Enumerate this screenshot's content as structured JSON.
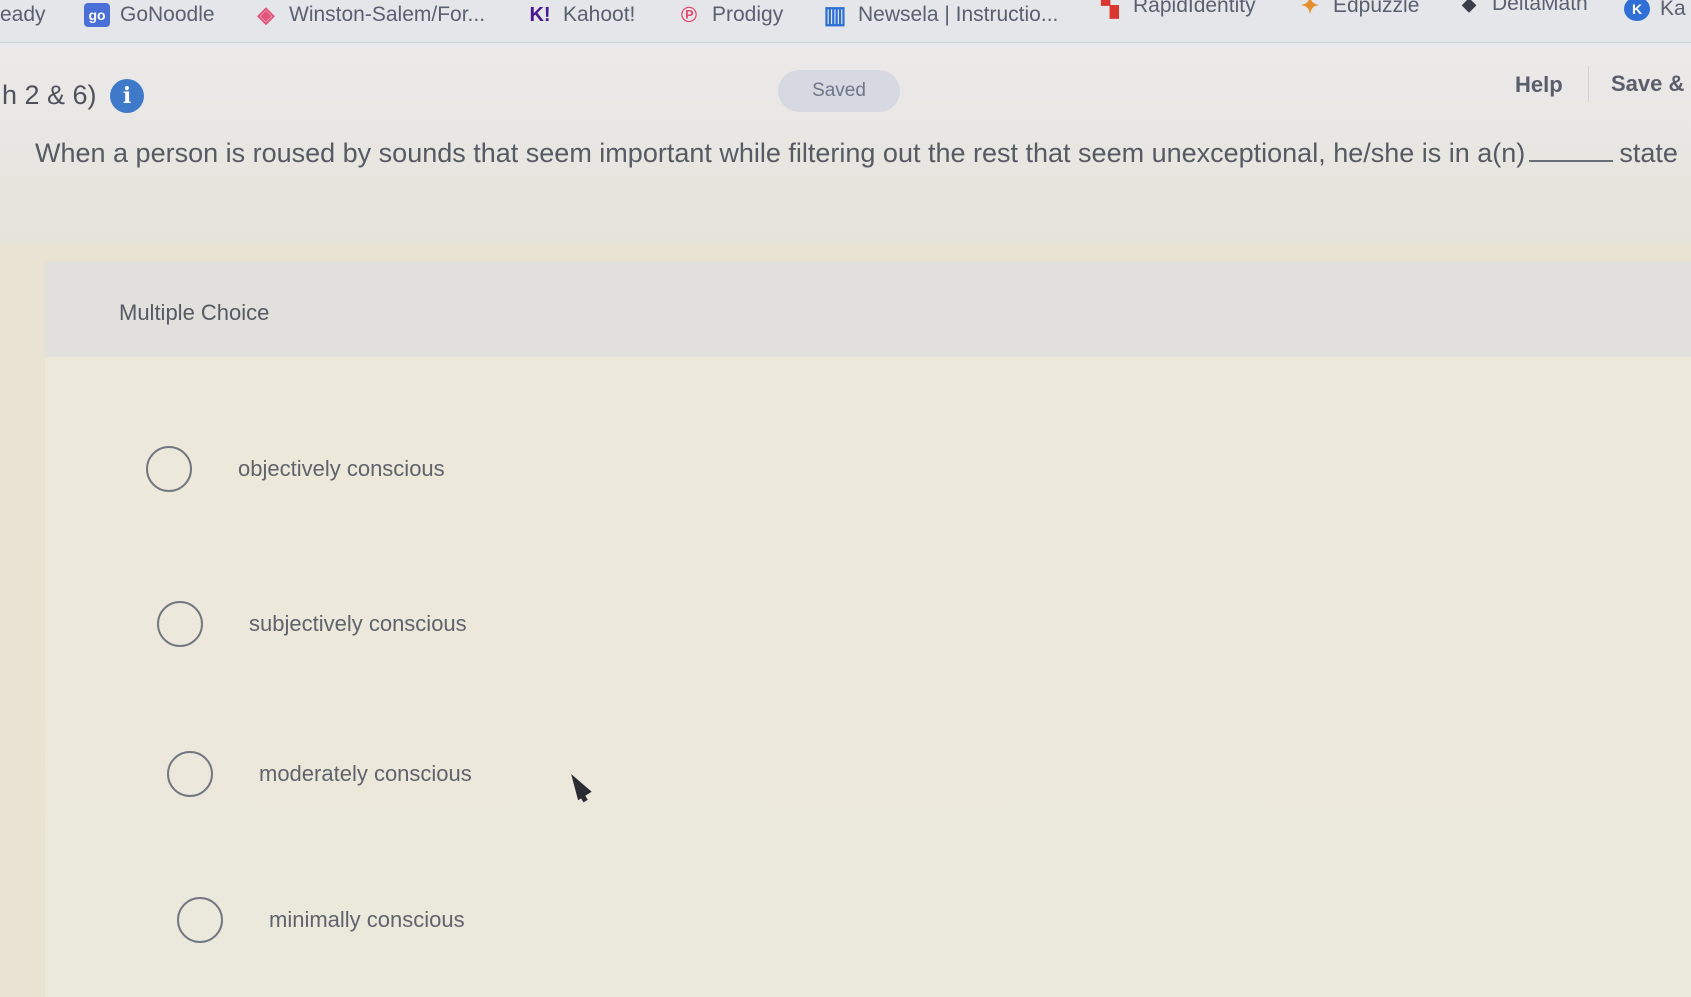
{
  "bookmarks": [
    {
      "label": "eady",
      "icon": "",
      "icon_color": ""
    },
    {
      "label": "GoNoodle",
      "icon": "go",
      "icon_color": "#4a6fd6"
    },
    {
      "label": "Winston-Salem/For...",
      "icon": "◈",
      "icon_color": "#e3557a"
    },
    {
      "label": "Kahoot!",
      "icon": "K!",
      "icon_color": "#46178f"
    },
    {
      "label": "Prodigy",
      "icon": "℗",
      "icon_color": "#e5436b"
    },
    {
      "label": "Newsela | Instructio...",
      "icon": "▥",
      "icon_color": "#2b6fd6"
    },
    {
      "label": "RapidIdentity",
      "icon": "▚",
      "icon_color": "#d9372f"
    },
    {
      "label": "Edpuzzle",
      "icon": "✦",
      "icon_color": "#e78e2c"
    },
    {
      "label": "DeltaMath",
      "icon": "◆",
      "icon_color": "#3a3f4a"
    },
    {
      "label": "Ka",
      "icon": "K",
      "icon_color": "#2f6fd6"
    }
  ],
  "header": {
    "breadcrumb": "h 2 & 6)",
    "info_icon": "i",
    "status": "Saved",
    "help_label": "Help",
    "save_label": "Save &"
  },
  "question": {
    "prefix": "When a person is roused by sounds that seem important while filtering out the rest that seem unexceptional, he/she is in a(n)",
    "suffix": "state"
  },
  "multiple_choice": {
    "label": "Multiple Choice",
    "options": [
      "objectively conscious",
      "subjectively conscious",
      "moderately conscious",
      "minimally conscious"
    ]
  }
}
